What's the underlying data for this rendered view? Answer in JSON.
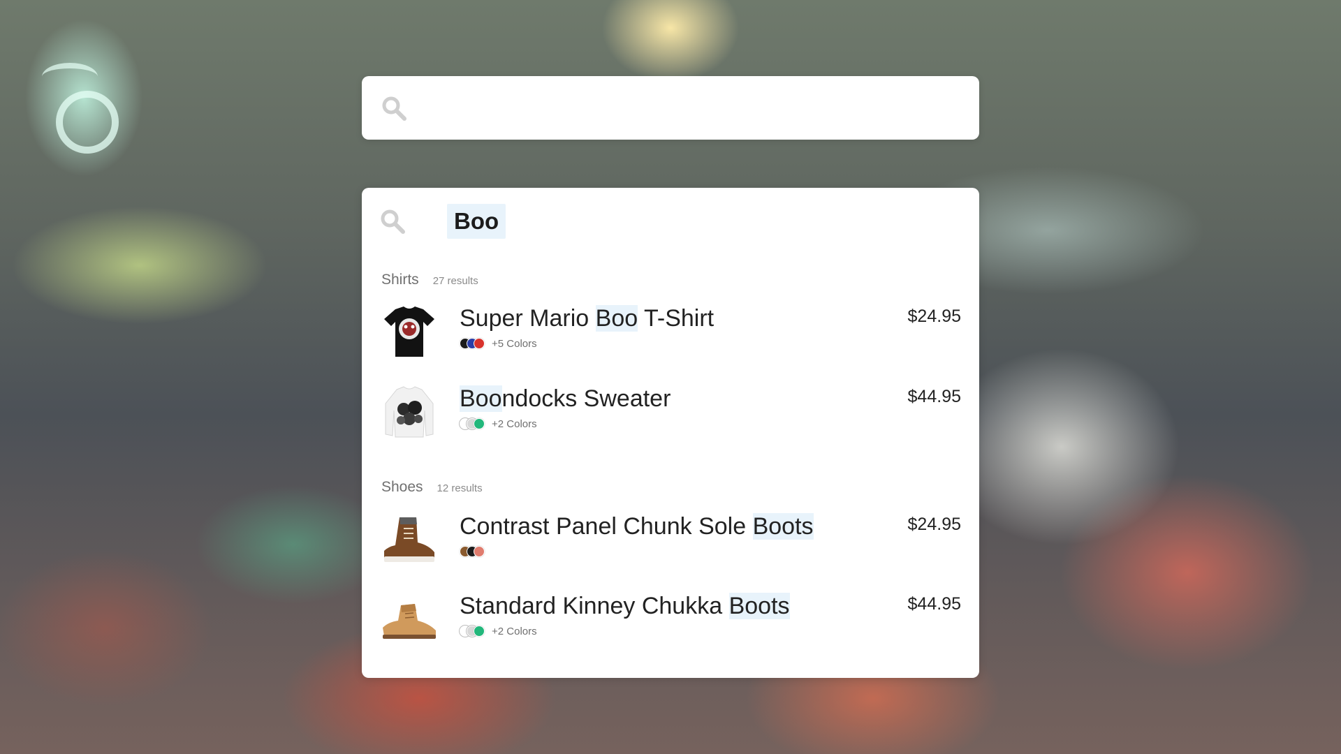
{
  "top_search": {
    "placeholder": "",
    "value": ""
  },
  "query": "Boo",
  "sections": [
    {
      "title": "Shirts",
      "count": "27 results",
      "items": [
        {
          "name_before": "Super Mario ",
          "name_highlight": "Boo",
          "name_after": " T-Shirt",
          "price": "$24.95",
          "swatches": [
            "#1b1b1b",
            "#2b3ea8",
            "#d8322c"
          ],
          "colors_label": "+5 Colors",
          "thumb": "t-shirt-image"
        },
        {
          "name_before": "",
          "name_highlight": "Boo",
          "name_after": "ndocks Sweater",
          "price": "$44.95",
          "swatches": [
            "#ffffff",
            "#d8d8d8",
            "#22b77b"
          ],
          "colors_label": "+2 Colors",
          "thumb": "sweater-image"
        }
      ]
    },
    {
      "title": "Shoes",
      "count": "12 results",
      "items": [
        {
          "name_before": "Contrast Panel Chunk Sole ",
          "name_highlight": "Boots",
          "name_after": "",
          "price": "$24.95",
          "swatches": [
            "#8a5a2e",
            "#1c1c1c",
            "#e07c6e"
          ],
          "colors_label": "",
          "thumb": "boot-image"
        },
        {
          "name_before": "Standard Kinney Chukka ",
          "name_highlight": "Boots",
          "name_after": "",
          "price": "$44.95",
          "swatches": [
            "#ffffff",
            "#d8d8d8",
            "#22b77b"
          ],
          "colors_label": "+2 Colors",
          "thumb": "chukka-boot-image"
        }
      ]
    }
  ],
  "colors": {
    "highlight": "#e8f3fb",
    "icon": "#cfcfcf"
  }
}
